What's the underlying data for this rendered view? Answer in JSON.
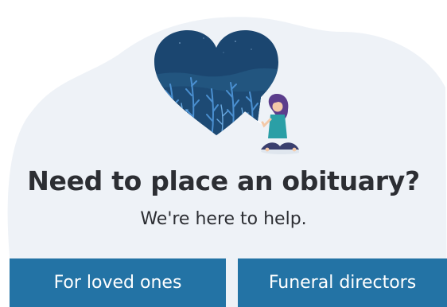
{
  "hero": {
    "headline": "Need to place an obituary?",
    "subhead": "We're here to help."
  },
  "actions": {
    "loved_ones_label": "For loved ones",
    "funeral_directors_label": "Funeral directors"
  },
  "illustration": {
    "icon": "heart-speech-bubble-woman-icon"
  },
  "colors": {
    "background_blob": "#eef2f7",
    "heart": "#1b4670",
    "button": "#2373a5",
    "button_text": "#ffffff",
    "text": "#2c2e33"
  }
}
